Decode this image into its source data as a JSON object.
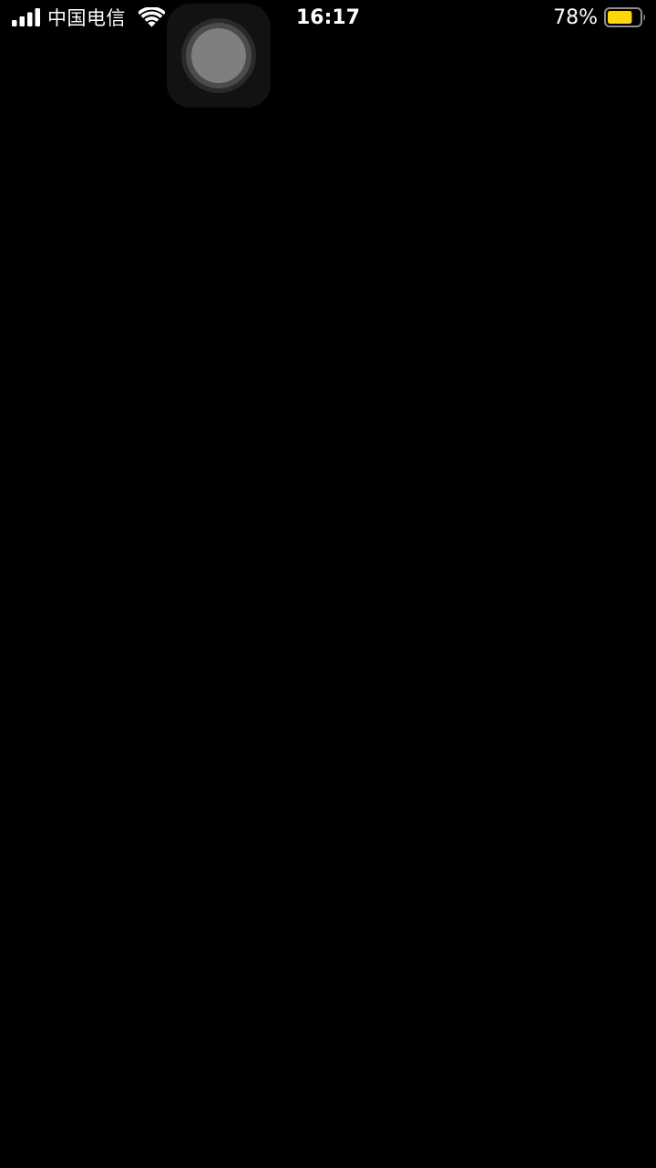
{
  "status_bar": {
    "carrier": "中国电信",
    "time": "16:17",
    "battery_percent": "78%",
    "battery_level": 0.78,
    "battery_color": "#ffd60a",
    "signal_icon": "cellular-signal-icon",
    "wifi_icon": "wifi-icon",
    "battery_icon": "battery-icon"
  },
  "screen": {
    "background_color": "#000000"
  },
  "assistive_touch": {
    "icon": "assistive-touch-icon"
  }
}
